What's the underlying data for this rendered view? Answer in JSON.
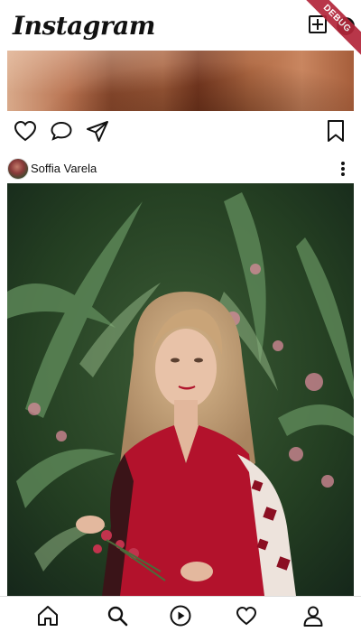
{
  "app_bar": {
    "logo": "Instagram",
    "new_post_icon": "add-square-icon",
    "messages_icon": "messenger-icon",
    "debug_banner": "DEBUG"
  },
  "previous_post": {
    "actions": [
      "heart-icon",
      "comment-icon",
      "send-icon",
      "bookmark-icon"
    ]
  },
  "post": {
    "username": "Soffia Varela",
    "more_icon": "more-vert-icon"
  },
  "bottom_nav": {
    "items": [
      "home-icon",
      "search-icon",
      "reels-icon",
      "heart-icon",
      "profile-icon"
    ]
  },
  "colors": {
    "ink": "#111111",
    "debug_ribbon": "#b3263a",
    "divider": "#dddddd"
  }
}
